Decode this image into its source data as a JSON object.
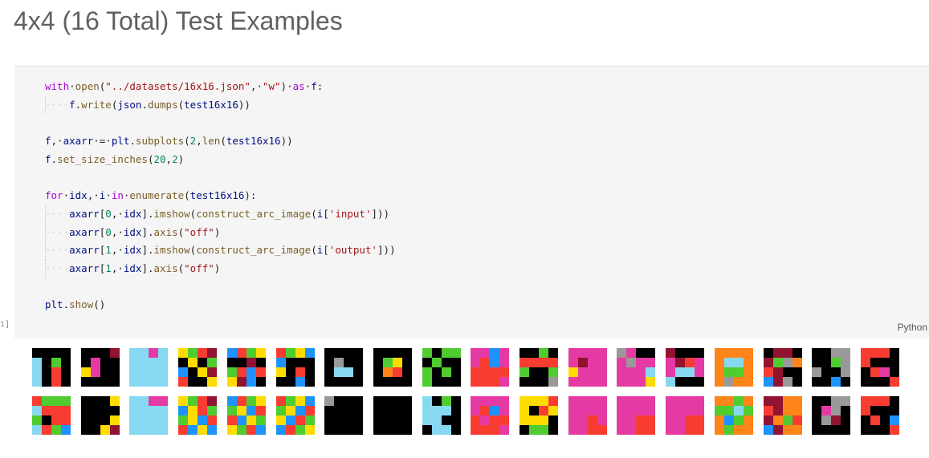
{
  "heading": "4x4 (16 Total) Test Examples",
  "cell": {
    "language": "Python",
    "exec_count": "1]",
    "code_lines": [
      [
        [
          "kw",
          "with"
        ],
        [
          "",
          "·"
        ],
        [
          "fn",
          "open"
        ],
        [
          "",
          "("
        ],
        [
          "str",
          "\"../datasets/16x16.json\""
        ],
        [
          "",
          ",·"
        ],
        [
          "str",
          "\"w\""
        ],
        [
          "",
          ")·"
        ],
        [
          "kw",
          "as"
        ],
        [
          "",
          "·"
        ],
        [
          "var",
          "f"
        ],
        [
          "",
          ":"
        ]
      ],
      [
        [
          "dot",
          "····"
        ],
        [
          "var",
          "f"
        ],
        [
          "",
          "."
        ],
        [
          "fn",
          "write"
        ],
        [
          "",
          "("
        ],
        [
          "var",
          "json"
        ],
        [
          "",
          "."
        ],
        [
          "fn",
          "dumps"
        ],
        [
          "",
          "("
        ],
        [
          "var",
          "test16x16"
        ],
        [
          "",
          "))"
        ]
      ],
      [],
      [
        [
          "var",
          "f"
        ],
        [
          "",
          ",·"
        ],
        [
          "var",
          "axarr"
        ],
        [
          "",
          "·=·"
        ],
        [
          "var",
          "plt"
        ],
        [
          "",
          "."
        ],
        [
          "fn",
          "subplots"
        ],
        [
          "",
          "("
        ],
        [
          "num",
          "2"
        ],
        [
          "",
          ","
        ],
        [
          "fn",
          "len"
        ],
        [
          "",
          "("
        ],
        [
          "var",
          "test16x16"
        ],
        [
          "",
          "))"
        ]
      ],
      [
        [
          "var",
          "f"
        ],
        [
          "",
          "."
        ],
        [
          "fn",
          "set_size_inches"
        ],
        [
          "",
          "("
        ],
        [
          "num",
          "20"
        ],
        [
          "",
          ","
        ],
        [
          "num",
          "2"
        ],
        [
          "",
          ")"
        ]
      ],
      [],
      [
        [
          "kw",
          "for"
        ],
        [
          "",
          "·"
        ],
        [
          "var",
          "idx"
        ],
        [
          "",
          ",·"
        ],
        [
          "var",
          "i"
        ],
        [
          "",
          "·"
        ],
        [
          "kw",
          "in"
        ],
        [
          "",
          "·"
        ],
        [
          "fn",
          "enumerate"
        ],
        [
          "",
          "("
        ],
        [
          "var",
          "test16x16"
        ],
        [
          "",
          "):"
        ]
      ],
      [
        [
          "dot",
          "····"
        ],
        [
          "var",
          "axarr"
        ],
        [
          "",
          "["
        ],
        [
          "num",
          "0"
        ],
        [
          "",
          ",·"
        ],
        [
          "var",
          "idx"
        ],
        [
          "",
          "]."
        ],
        [
          "fn",
          "imshow"
        ],
        [
          "",
          "("
        ],
        [
          "fn",
          "construct_arc_image"
        ],
        [
          "",
          "("
        ],
        [
          "var",
          "i"
        ],
        [
          "",
          "["
        ],
        [
          "str",
          "'input'"
        ],
        [
          "",
          "]))"
        ]
      ],
      [
        [
          "dot",
          "····"
        ],
        [
          "var",
          "axarr"
        ],
        [
          "",
          "["
        ],
        [
          "num",
          "0"
        ],
        [
          "",
          ",·"
        ],
        [
          "var",
          "idx"
        ],
        [
          "",
          "]."
        ],
        [
          "fn",
          "axis"
        ],
        [
          "",
          "("
        ],
        [
          "str",
          "\"off\""
        ],
        [
          "",
          ")"
        ]
      ],
      [
        [
          "dot",
          "····"
        ],
        [
          "var",
          "axarr"
        ],
        [
          "",
          "["
        ],
        [
          "num",
          "1"
        ],
        [
          "",
          ",·"
        ],
        [
          "var",
          "idx"
        ],
        [
          "",
          "]."
        ],
        [
          "fn",
          "imshow"
        ],
        [
          "",
          "("
        ],
        [
          "fn",
          "construct_arc_image"
        ],
        [
          "",
          "("
        ],
        [
          "var",
          "i"
        ],
        [
          "",
          "["
        ],
        [
          "str",
          "'output'"
        ],
        [
          "",
          "]))"
        ]
      ],
      [
        [
          "dot",
          "····"
        ],
        [
          "var",
          "axarr"
        ],
        [
          "",
          "["
        ],
        [
          "num",
          "1"
        ],
        [
          "",
          ",·"
        ],
        [
          "var",
          "idx"
        ],
        [
          "",
          "]."
        ],
        [
          "fn",
          "axis"
        ],
        [
          "",
          "("
        ],
        [
          "str",
          "\"off\""
        ],
        [
          "",
          ")"
        ]
      ],
      [],
      [
        [
          "var",
          "plt"
        ],
        [
          "",
          "."
        ],
        [
          "fn",
          "show"
        ],
        [
          "",
          "()"
        ]
      ]
    ]
  },
  "palette": {
    "0": "#000000",
    "1": "#1e93ff",
    "2": "#f93c31",
    "3": "#4fcc30",
    "4": "#ffdc00",
    "5": "#999999",
    "6": "#e53aa3",
    "7": "#ff851b",
    "8": "#87d8f1",
    "9": "#921231"
  },
  "output": {
    "rows": [
      [
        [
          "0000",
          "8030",
          "8020",
          "8020"
        ],
        [
          "0009",
          "0600",
          "4600",
          "0000"
        ],
        [
          "8868",
          "8888",
          "8888",
          "8888"
        ],
        [
          "4329",
          "0403",
          "1049",
          "2004"
        ],
        [
          "1234",
          "0090",
          "3212",
          "4910"
        ],
        [
          "2341",
          "1000",
          "4020",
          "0010"
        ],
        [
          "0000",
          "0500",
          "0880",
          "0000"
        ],
        [
          "0000",
          "0340",
          "0720",
          "0000"
        ],
        [
          "3033",
          "0300",
          "3030",
          "3000"
        ],
        [
          "6616",
          "6216",
          "2222",
          "2226"
        ],
        [
          "0030",
          "2222",
          "3003",
          "0005"
        ],
        [
          "6666",
          "6966",
          "4666",
          "6666"
        ],
        [
          "5600",
          "6566",
          "6668",
          "6664"
        ],
        [
          "9000",
          "6926",
          "6886",
          "8000"
        ],
        [
          "7777",
          "7887",
          "7337",
          "7577"
        ],
        [
          "0990",
          "9357",
          "2900",
          "1950"
        ],
        [
          "0055",
          "0035",
          "5005",
          "0010"
        ],
        [
          "2220",
          "2000",
          "0260",
          "0002"
        ]
      ],
      [
        [
          "2333",
          "8222",
          "3022",
          "8231"
        ],
        [
          "0004",
          "0000",
          "0004",
          "0049"
        ],
        [
          "8866",
          "8888",
          "8888",
          "8888"
        ],
        [
          "4329",
          "1423",
          "3412",
          "2141"
        ],
        [
          "1234",
          "3412",
          "2143",
          "4321"
        ],
        [
          "2341",
          "3412",
          "4123",
          "1234"
        ],
        [
          "5000",
          "0000",
          "0000",
          "0000"
        ],
        [
          "0000",
          "0000",
          "0000",
          "0000"
        ],
        [
          "8030",
          "8880",
          "8800",
          "0880"
        ],
        [
          "6666",
          "6216",
          "2622",
          "2226"
        ],
        [
          "4442",
          "4024",
          "4440",
          "0330"
        ],
        [
          "6666",
          "6666",
          "6626",
          "6622"
        ],
        [
          "6666",
          "6666",
          "6622",
          "6622"
        ],
        [
          "6666",
          "6666",
          "6622",
          "6622"
        ],
        [
          "7737",
          "3383",
          "7137",
          "7377"
        ],
        [
          "9977",
          "2977",
          "9732",
          "1977"
        ],
        [
          "0055",
          "0650",
          "0590",
          "0000"
        ],
        [
          "2220",
          "2000",
          "0201",
          "0002"
        ]
      ]
    ]
  }
}
